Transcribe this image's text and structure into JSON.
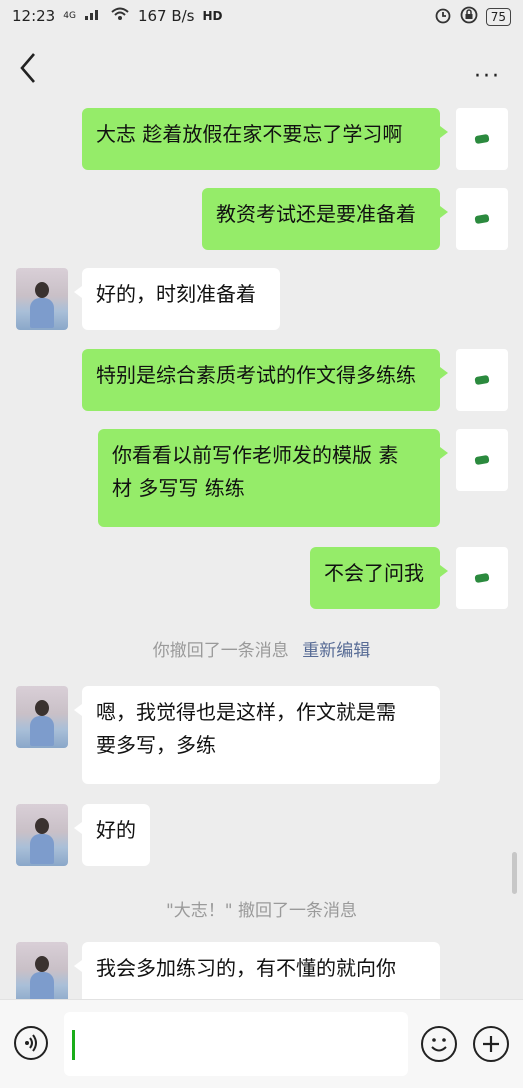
{
  "status_bar": {
    "time": "12:23",
    "network": "4G",
    "speed": "167 B/s",
    "hd": "HD",
    "battery": "75"
  },
  "header": {
    "back_icon": "chevron-left-icon",
    "more_icon": "more-horizontal-icon",
    "more_label": "···"
  },
  "messages": [
    {
      "side": "sent",
      "text": "大志  趁着放假在家不要忘了学习啊"
    },
    {
      "side": "sent",
      "text": "教资考试还是要准备着"
    },
    {
      "side": "received",
      "text": "好的，时刻准备着"
    },
    {
      "side": "sent",
      "text": "特别是综合素质考试的作文得多练练"
    },
    {
      "side": "sent",
      "text_line1": "你看看以前写作老师发的模版   素",
      "text_line2": "材  多写写   练练"
    },
    {
      "side": "sent",
      "text": "不会了问我"
    },
    {
      "side": "system",
      "text": "你撤回了一条消息",
      "action": "重新编辑"
    },
    {
      "side": "received",
      "text_line1": "嗯，我觉得也是这样，作文就是需",
      "text_line2": "要多写，多练"
    },
    {
      "side": "received",
      "text": "好的"
    },
    {
      "side": "system",
      "text": "\"大志！\" 撤回了一条消息"
    },
    {
      "side": "received",
      "text": "我会多加练习的，有不懂的就向你"
    }
  ],
  "input_bar": {
    "voice_icon": "voice-icon",
    "emoji_icon": "emoji-icon",
    "plus_icon": "plus-icon",
    "value": ""
  }
}
